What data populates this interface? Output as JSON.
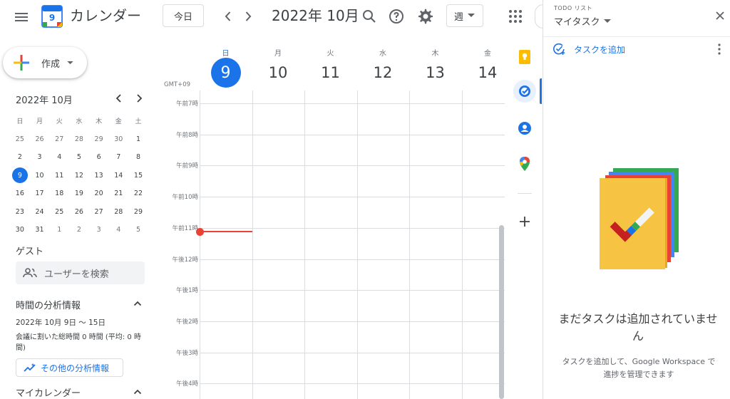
{
  "header": {
    "app_title": "カレンダー",
    "logo_day": "9",
    "today_label": "今日",
    "period_title": "2022年 10月",
    "view_label": "週"
  },
  "sidebar": {
    "create_label": "作成",
    "mini_calendar": {
      "month_title": "2022年 10月",
      "weekdays": [
        "日",
        "月",
        "火",
        "水",
        "木",
        "金",
        "土"
      ],
      "weeks": [
        [
          "25",
          "26",
          "27",
          "28",
          "29",
          "30",
          "1"
        ],
        [
          "2",
          "3",
          "4",
          "5",
          "6",
          "7",
          "8"
        ],
        [
          "9",
          "10",
          "11",
          "12",
          "13",
          "14",
          "15"
        ],
        [
          "16",
          "17",
          "18",
          "19",
          "20",
          "21",
          "22"
        ],
        [
          "23",
          "24",
          "25",
          "26",
          "27",
          "28",
          "29"
        ],
        [
          "30",
          "31",
          "1",
          "2",
          "3",
          "4",
          "5"
        ]
      ],
      "today": "9"
    },
    "guests": {
      "title": "ゲスト",
      "search_placeholder": "ユーザーを検索"
    },
    "insights": {
      "title": "時間の分析情報",
      "range": "2022年 10月 9日 〜 15日",
      "summary": "会議に割いた総時間 0 時間 (平均: 0 時間)",
      "more_label": "その他の分析情報"
    },
    "my_calendars_title": "マイカレンダー"
  },
  "week": {
    "timezone": "GMT+09",
    "days": [
      {
        "dow": "日",
        "num": "9",
        "today": true
      },
      {
        "dow": "月",
        "num": "10",
        "today": false
      },
      {
        "dow": "火",
        "num": "11",
        "today": false
      },
      {
        "dow": "水",
        "num": "12",
        "today": false
      },
      {
        "dow": "木",
        "num": "13",
        "today": false
      },
      {
        "dow": "金",
        "num": "14",
        "today": false
      }
    ],
    "hours": [
      "午前7時",
      "午前8時",
      "午前9時",
      "午前10時",
      "午前11時",
      "午後12時",
      "午後1時",
      "午後2時",
      "午後3時",
      "午後4時"
    ]
  },
  "tasks_panel": {
    "label": "TODO リスト",
    "list_name": "マイタスク",
    "add_label": "タスクを追加",
    "empty_title": "まだタスクは追加されていません",
    "empty_desc": "タスクを追加して、Google Workspace で進捗を管理できます"
  },
  "colors": {
    "accent": "#1a73e8",
    "now_line": "#ea4335",
    "keep": "#fbbc04",
    "maps_red": "#ea4335",
    "maps_green": "#34a853"
  }
}
